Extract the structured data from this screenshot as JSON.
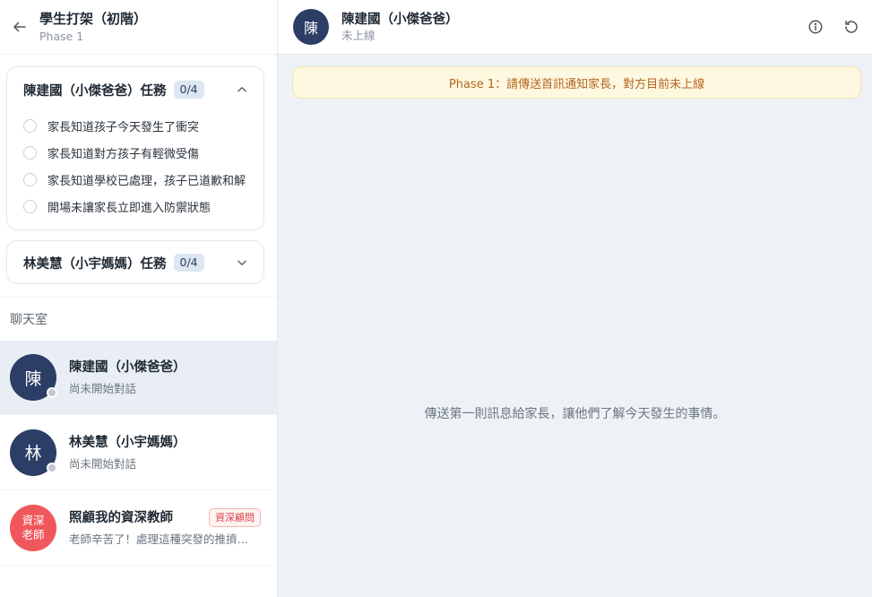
{
  "sidebar": {
    "title": "學生打架（初階）",
    "subtitle": "Phase 1",
    "tasks": [
      {
        "title": "陳建國（小傑爸爸）任務",
        "badge": "0/4",
        "expanded": true,
        "items": [
          "家長知道孩子今天發生了衝突",
          "家長知道對方孩子有輕微受傷",
          "家長知道學校已處理，孩子已道歉和解",
          "開場未讓家長立即進入防禦狀態"
        ]
      },
      {
        "title": "林美慧（小宇媽媽）任務",
        "badge": "0/4",
        "expanded": false
      }
    ],
    "chat_label": "聊天室",
    "chats": [
      {
        "avatar": "陳",
        "name": "陳建國（小傑爸爸）",
        "preview": "尚未開始對話",
        "active": true
      },
      {
        "avatar": "林",
        "name": "林美慧（小宇媽媽）",
        "preview": "尚未開始對話",
        "active": false
      },
      {
        "avatar_line1": "資深",
        "avatar_line2": "老師",
        "name": "照顧我的資深教師",
        "tag": "資深顧問",
        "preview": "老師辛苦了！處理這種突發的推擠…",
        "active": false
      }
    ]
  },
  "conversation": {
    "avatar": "陳",
    "name": "陳建國（小傑爸爸）",
    "status": "未上線",
    "banner": "Phase 1：請傳送首訊通知家長，對方目前未上線",
    "empty_hint": "傳送第一則訊息給家長，讓他們了解今天發生的事情。"
  },
  "icons": {
    "back": "arrow-left-icon",
    "collapse": "chevron-up-icon",
    "expand": "chevron-down-icon",
    "info": "info-icon",
    "reset": "refresh-icon"
  },
  "colors": {
    "avatar_navy": "#2c3e66",
    "avatar_red": "#f0575c",
    "banner_bg": "#fef8e1",
    "banner_text": "#b4651d",
    "badge_bg": "#dde6f1",
    "tag_text": "#d9434a",
    "active_row": "#e9eef5"
  }
}
